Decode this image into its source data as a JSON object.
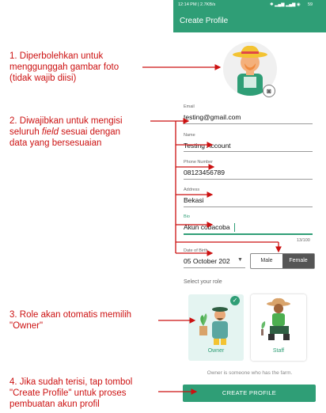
{
  "status_bar": {
    "time": "12:14 PM | 2.7KB/s",
    "battery": "59"
  },
  "app_bar": {
    "title": "Create Profile"
  },
  "form": {
    "email": {
      "label": "Email",
      "value": "testing@gmail.com"
    },
    "name": {
      "label": "Name",
      "value": "Testing Account"
    },
    "phone": {
      "label": "Phone Number",
      "value": "08123456789"
    },
    "address": {
      "label": "Address",
      "value": "Bekasi"
    },
    "bio": {
      "label": "Bio",
      "value": "Akun cobacoba",
      "counter": "13/100"
    },
    "dob": {
      "label": "Date of Birth",
      "value": "05 October 202"
    },
    "gender": {
      "male": "Male",
      "female": "Female",
      "selected": "Female"
    },
    "role_title": "Select your role",
    "roles": [
      {
        "label": "Owner"
      },
      {
        "label": "Staff"
      }
    ],
    "role_hint": "Owner is someone who has the farm.",
    "submit": "CREATE PROFILE"
  },
  "annotations": {
    "a1": [
      "1. Diperbolehkan untuk",
      "menggunggah gambar foto",
      "(tidak wajib diisi)"
    ],
    "a2_line1": "2. Diwajibkan untuk mengisi",
    "a2_line2_pre": "seluruh ",
    "a2_line2_em": "field",
    "a2_line2_post": " sesuai dengan",
    "a2_line3": "data yang bersesuaian",
    "a3": [
      "3. Role akan otomatis memilih",
      "\"Owner\""
    ],
    "a4": [
      "4. Jika sudah terisi, tap tombol",
      "\"Create Profile\" untuk proses",
      "pembuatan akun profil"
    ]
  },
  "colors": {
    "primary": "#2f9e76",
    "annotation": "#cc1111",
    "dark_toggle": "#555555"
  }
}
